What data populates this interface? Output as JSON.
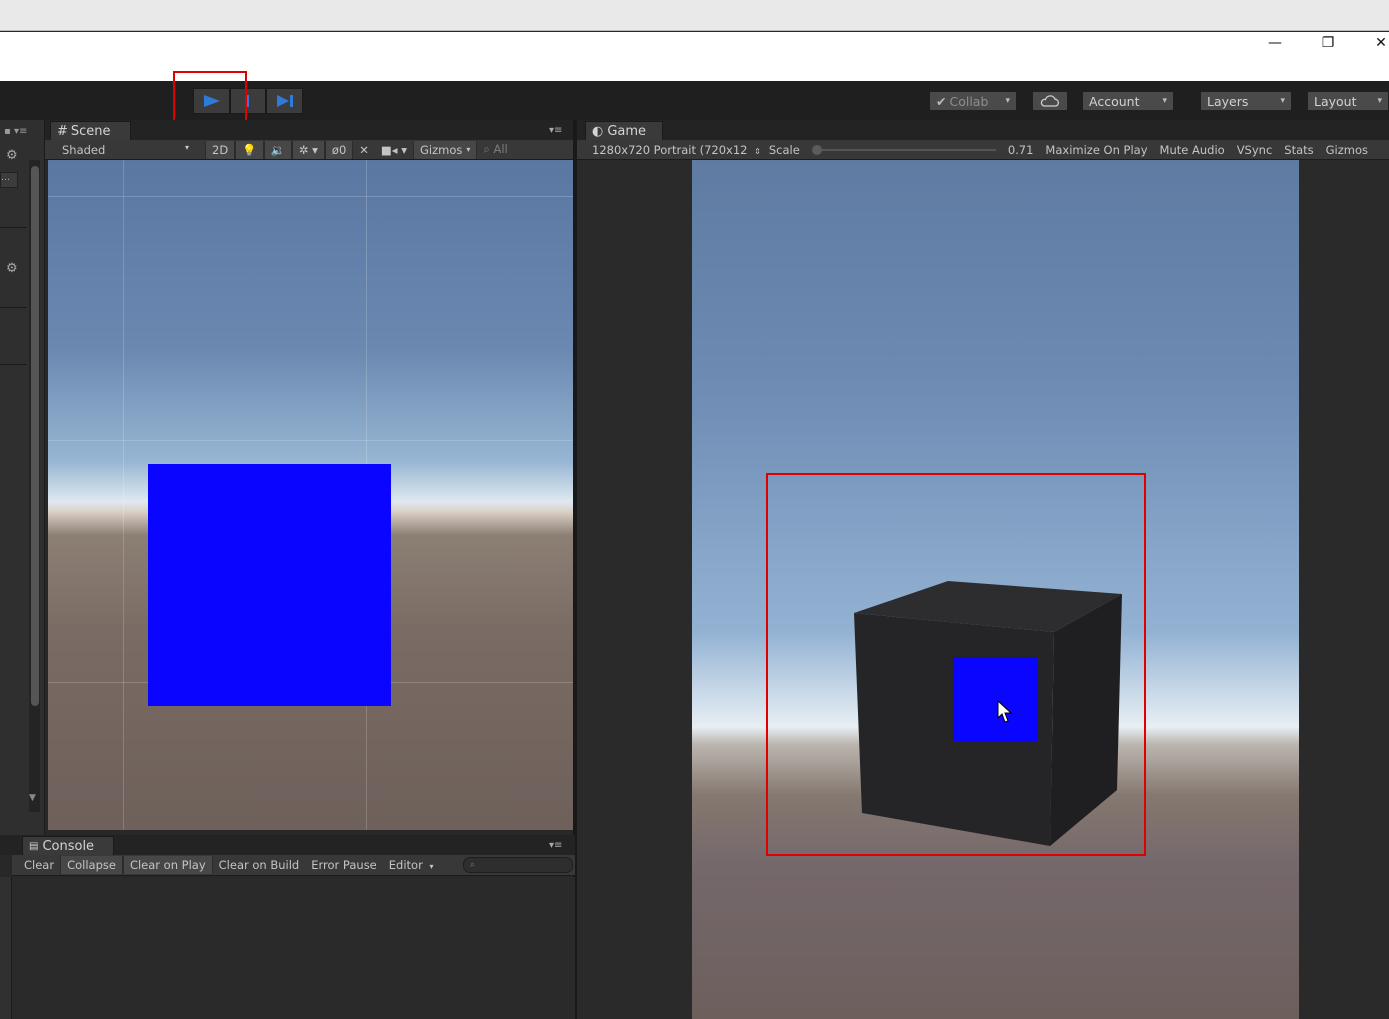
{
  "window": {
    "controls": {
      "minimize": "—",
      "restore": "❐",
      "close": "✕"
    }
  },
  "toolbar": {
    "play_icon": "play-icon",
    "pause_icon": "pause-icon",
    "step_icon": "step-icon",
    "collab": "Collab",
    "account": "Account",
    "layers": "Layers",
    "layout": "Layout"
  },
  "scene": {
    "tab": "Scene",
    "shading": "Shaded",
    "mode_2d": "2D",
    "hidden_count": "0",
    "gizmos": "Gizmos",
    "search": "All"
  },
  "game": {
    "tab": "Game",
    "resolution": "1280x720 Portrait (720x12",
    "scale_label": "Scale",
    "scale_value": "0.71",
    "maximize": "Maximize On Play",
    "mute": "Mute Audio",
    "vsync": "VSync",
    "stats": "Stats",
    "gizmos": "Gizmos"
  },
  "console": {
    "tab": "Console",
    "buttons": [
      "Clear",
      "Collapse",
      "Clear on Play",
      "Clear on Build",
      "Error Pause",
      "Editor"
    ]
  },
  "colors": {
    "highlight": "#e00000",
    "play_blue": "#2f7bd9",
    "quad_blue": "#0a05ff"
  }
}
